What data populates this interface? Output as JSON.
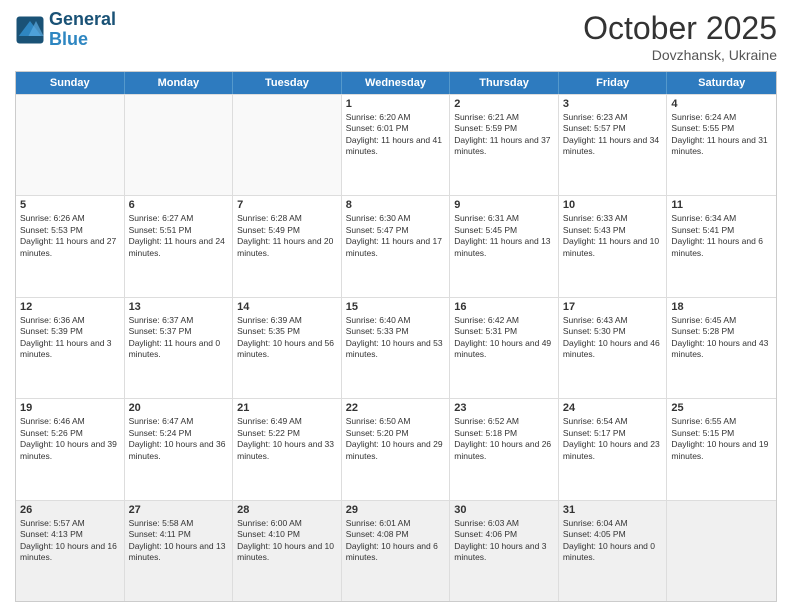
{
  "logo": {
    "line1": "General",
    "line2": "Blue"
  },
  "title": "October 2025",
  "subtitle": "Dovzhansk, Ukraine",
  "header": {
    "days": [
      "Sunday",
      "Monday",
      "Tuesday",
      "Wednesday",
      "Thursday",
      "Friday",
      "Saturday"
    ]
  },
  "weeks": [
    [
      {
        "day": "",
        "info": ""
      },
      {
        "day": "",
        "info": ""
      },
      {
        "day": "",
        "info": ""
      },
      {
        "day": "1",
        "info": "Sunrise: 6:20 AM\nSunset: 6:01 PM\nDaylight: 11 hours and 41 minutes."
      },
      {
        "day": "2",
        "info": "Sunrise: 6:21 AM\nSunset: 5:59 PM\nDaylight: 11 hours and 37 minutes."
      },
      {
        "day": "3",
        "info": "Sunrise: 6:23 AM\nSunset: 5:57 PM\nDaylight: 11 hours and 34 minutes."
      },
      {
        "day": "4",
        "info": "Sunrise: 6:24 AM\nSunset: 5:55 PM\nDaylight: 11 hours and 31 minutes."
      }
    ],
    [
      {
        "day": "5",
        "info": "Sunrise: 6:26 AM\nSunset: 5:53 PM\nDaylight: 11 hours and 27 minutes."
      },
      {
        "day": "6",
        "info": "Sunrise: 6:27 AM\nSunset: 5:51 PM\nDaylight: 11 hours and 24 minutes."
      },
      {
        "day": "7",
        "info": "Sunrise: 6:28 AM\nSunset: 5:49 PM\nDaylight: 11 hours and 20 minutes."
      },
      {
        "day": "8",
        "info": "Sunrise: 6:30 AM\nSunset: 5:47 PM\nDaylight: 11 hours and 17 minutes."
      },
      {
        "day": "9",
        "info": "Sunrise: 6:31 AM\nSunset: 5:45 PM\nDaylight: 11 hours and 13 minutes."
      },
      {
        "day": "10",
        "info": "Sunrise: 6:33 AM\nSunset: 5:43 PM\nDaylight: 11 hours and 10 minutes."
      },
      {
        "day": "11",
        "info": "Sunrise: 6:34 AM\nSunset: 5:41 PM\nDaylight: 11 hours and 6 minutes."
      }
    ],
    [
      {
        "day": "12",
        "info": "Sunrise: 6:36 AM\nSunset: 5:39 PM\nDaylight: 11 hours and 3 minutes."
      },
      {
        "day": "13",
        "info": "Sunrise: 6:37 AM\nSunset: 5:37 PM\nDaylight: 11 hours and 0 minutes."
      },
      {
        "day": "14",
        "info": "Sunrise: 6:39 AM\nSunset: 5:35 PM\nDaylight: 10 hours and 56 minutes."
      },
      {
        "day": "15",
        "info": "Sunrise: 6:40 AM\nSunset: 5:33 PM\nDaylight: 10 hours and 53 minutes."
      },
      {
        "day": "16",
        "info": "Sunrise: 6:42 AM\nSunset: 5:31 PM\nDaylight: 10 hours and 49 minutes."
      },
      {
        "day": "17",
        "info": "Sunrise: 6:43 AM\nSunset: 5:30 PM\nDaylight: 10 hours and 46 minutes."
      },
      {
        "day": "18",
        "info": "Sunrise: 6:45 AM\nSunset: 5:28 PM\nDaylight: 10 hours and 43 minutes."
      }
    ],
    [
      {
        "day": "19",
        "info": "Sunrise: 6:46 AM\nSunset: 5:26 PM\nDaylight: 10 hours and 39 minutes."
      },
      {
        "day": "20",
        "info": "Sunrise: 6:47 AM\nSunset: 5:24 PM\nDaylight: 10 hours and 36 minutes."
      },
      {
        "day": "21",
        "info": "Sunrise: 6:49 AM\nSunset: 5:22 PM\nDaylight: 10 hours and 33 minutes."
      },
      {
        "day": "22",
        "info": "Sunrise: 6:50 AM\nSunset: 5:20 PM\nDaylight: 10 hours and 29 minutes."
      },
      {
        "day": "23",
        "info": "Sunrise: 6:52 AM\nSunset: 5:18 PM\nDaylight: 10 hours and 26 minutes."
      },
      {
        "day": "24",
        "info": "Sunrise: 6:54 AM\nSunset: 5:17 PM\nDaylight: 10 hours and 23 minutes."
      },
      {
        "day": "25",
        "info": "Sunrise: 6:55 AM\nSunset: 5:15 PM\nDaylight: 10 hours and 19 minutes."
      }
    ],
    [
      {
        "day": "26",
        "info": "Sunrise: 5:57 AM\nSunset: 4:13 PM\nDaylight: 10 hours and 16 minutes."
      },
      {
        "day": "27",
        "info": "Sunrise: 5:58 AM\nSunset: 4:11 PM\nDaylight: 10 hours and 13 minutes."
      },
      {
        "day": "28",
        "info": "Sunrise: 6:00 AM\nSunset: 4:10 PM\nDaylight: 10 hours and 10 minutes."
      },
      {
        "day": "29",
        "info": "Sunrise: 6:01 AM\nSunset: 4:08 PM\nDaylight: 10 hours and 6 minutes."
      },
      {
        "day": "30",
        "info": "Sunrise: 6:03 AM\nSunset: 4:06 PM\nDaylight: 10 hours and 3 minutes."
      },
      {
        "day": "31",
        "info": "Sunrise: 6:04 AM\nSunset: 4:05 PM\nDaylight: 10 hours and 0 minutes."
      },
      {
        "day": "",
        "info": ""
      }
    ]
  ]
}
